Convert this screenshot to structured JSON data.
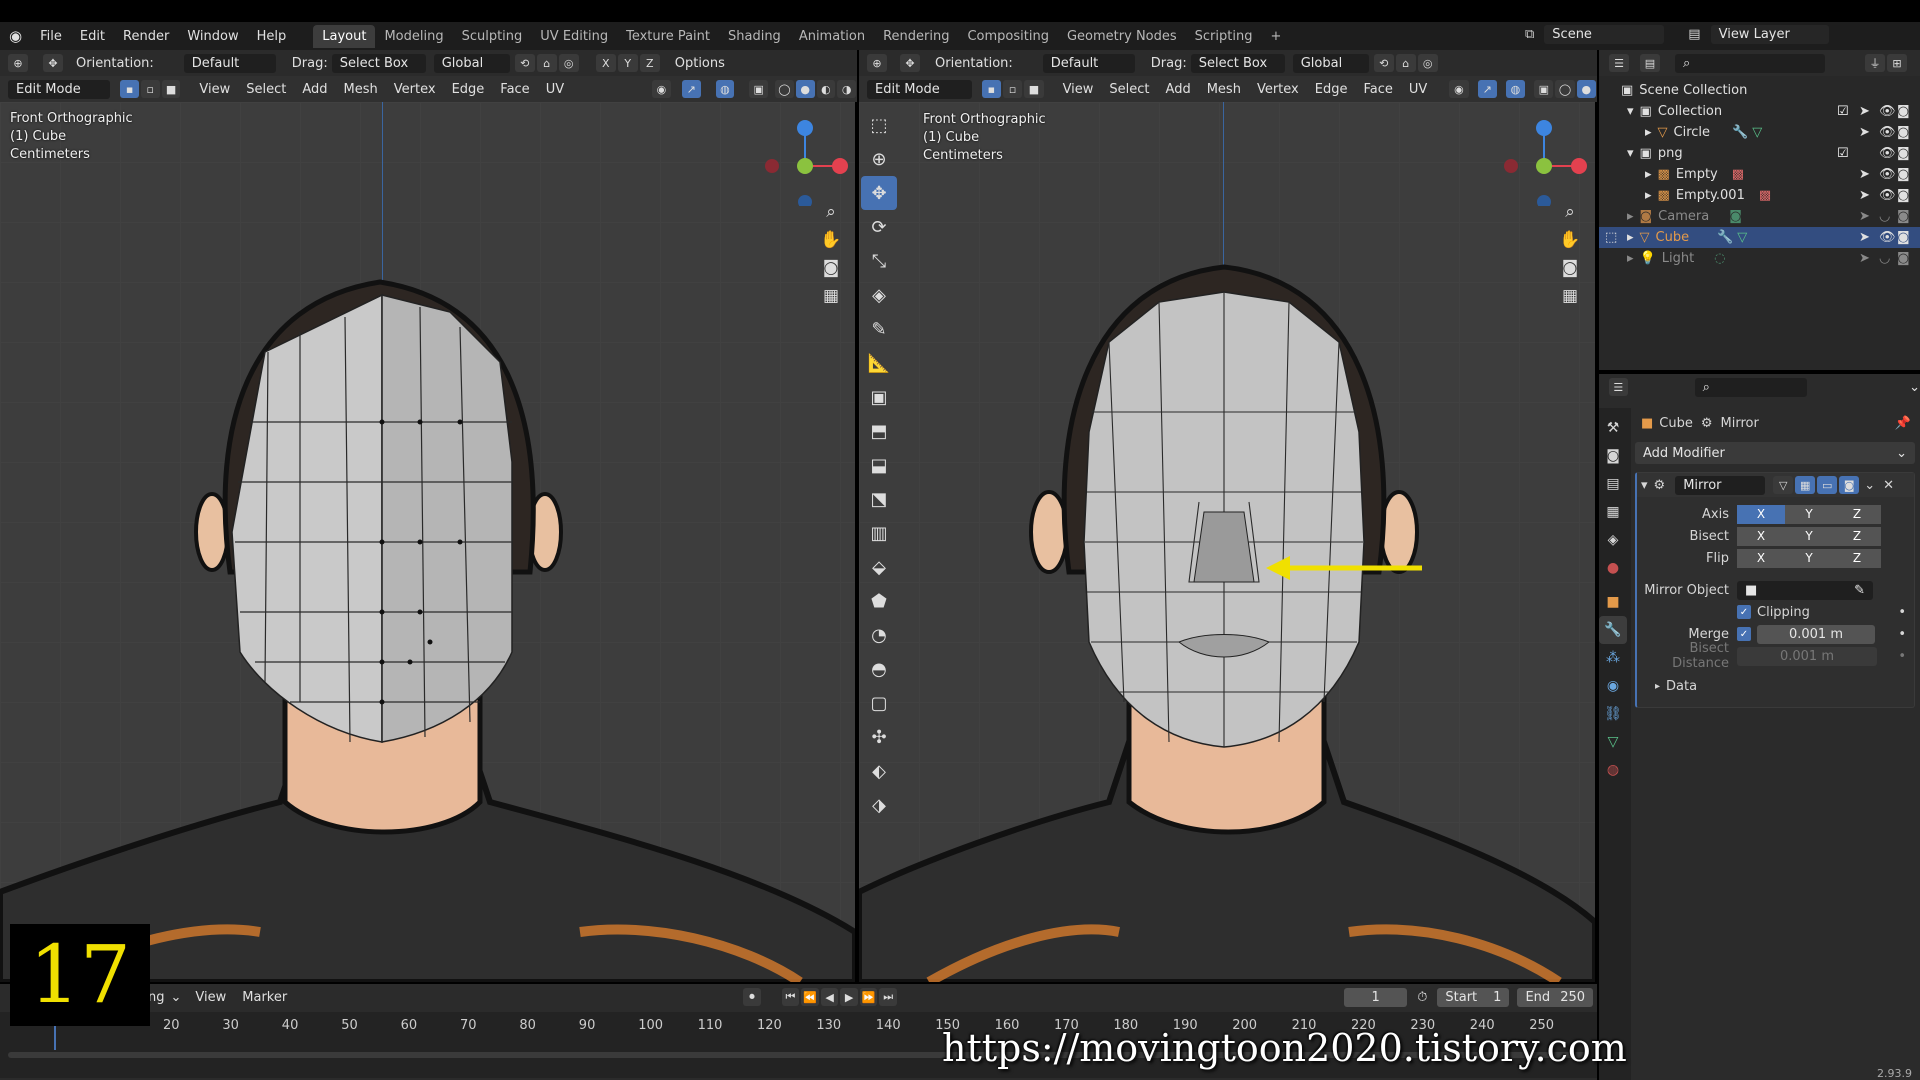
{
  "app_menu": [
    "File",
    "Edit",
    "Render",
    "Window",
    "Help"
  ],
  "workspaces": [
    "Layout",
    "Modeling",
    "Sculpting",
    "UV Editing",
    "Texture Paint",
    "Shading",
    "Animation",
    "Rendering",
    "Compositing",
    "Geometry Nodes",
    "Scripting"
  ],
  "active_workspace": "Layout",
  "add_workspace": "+",
  "scene_name": "Scene",
  "view_layer": "View Layer",
  "left_header": {
    "orientation_label": "Orientation:",
    "orientation_value": "Default",
    "drag_label": "Drag:",
    "drag_value": "Select Box",
    "transform_space": "Global",
    "axis_x": "X",
    "axis_y": "Y",
    "axis_z": "Z",
    "options": "Options"
  },
  "right_header": {
    "orientation_label": "Orientation:",
    "orientation_value": "Default",
    "drag_label": "Drag:",
    "drag_value": "Select Box",
    "transform_space": "Global"
  },
  "edit_menu": {
    "mode": "Edit Mode",
    "items": [
      "View",
      "Select",
      "Add",
      "Mesh",
      "Vertex",
      "Edge",
      "Face",
      "UV"
    ]
  },
  "left_view": {
    "line1": "Front Orthographic",
    "line2": "(1) Cube",
    "line3": "Centimeters"
  },
  "right_view": {
    "line1": "Front Orthographic",
    "line2": "(1) Cube",
    "line3": "Centimeters"
  },
  "gizmo": {
    "x": "X",
    "y": "Y",
    "z": "Z",
    "x_color": "#e3414f",
    "y_color": "#8bc23f",
    "z_color": "#3d85e0"
  },
  "outliner": {
    "rows": [
      {
        "label": "Scene Collection"
      },
      {
        "label": "Collection"
      },
      {
        "label": "Circle"
      },
      {
        "label": "png"
      },
      {
        "label": "Empty"
      },
      {
        "label": "Empty.001"
      },
      {
        "label": "Camera"
      },
      {
        "label": "Cube"
      },
      {
        "label": "Light"
      }
    ]
  },
  "properties": {
    "object_name": "Cube",
    "modifier_crumb": "Mirror",
    "add_modifier": "Add Modifier",
    "modifier_name": "Mirror",
    "axis_label": "Axis",
    "bisect_label": "Bisect",
    "flip_label": "Flip",
    "x": "X",
    "y": "Y",
    "z": "Z",
    "mirror_object_label": "Mirror Object",
    "clipping_label": "Clipping",
    "merge_label": "Merge",
    "merge_value": "0.001 m",
    "bisect_distance_label": "Bisect Distance",
    "bisect_distance_value": "0.001 m",
    "data_label": "Data"
  },
  "timeline": {
    "menu_partial": "ng",
    "view": "View",
    "marker": "Marker",
    "current_frame": "1",
    "start_label": "Start",
    "start_value": "1",
    "end_label": "End",
    "end_value": "250",
    "ticks": [
      "20",
      "30",
      "40",
      "50",
      "60",
      "70",
      "80",
      "90",
      "100",
      "110",
      "120",
      "130",
      "140",
      "150",
      "160",
      "170",
      "180",
      "190",
      "200",
      "210",
      "220",
      "230",
      "240",
      "250"
    ]
  },
  "version": "2.93.9",
  "overlay_number": "17",
  "watermark": "https://movingtoon2020.tistory.com",
  "arrow_color": "#f0e000"
}
